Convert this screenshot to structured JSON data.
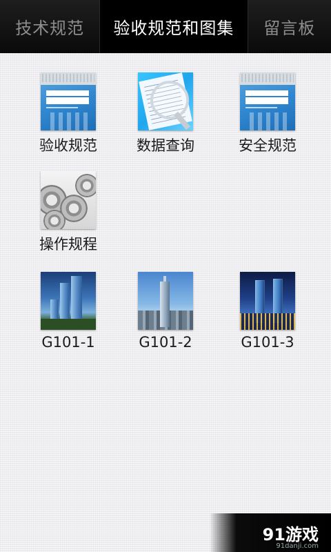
{
  "tabs": [
    {
      "label": "技术规范"
    },
    {
      "label": "验收规范和图集"
    },
    {
      "label": "留言板"
    }
  ],
  "grid": {
    "items": [
      {
        "label": "验收规范",
        "icon": "book-cover-icon"
      },
      {
        "label": "数据查询",
        "icon": "magnifier-document-icon"
      },
      {
        "label": "安全规范",
        "icon": "book-cover-icon"
      },
      {
        "label": "操作规程",
        "icon": "gears-icon"
      },
      {
        "label": "G101-1",
        "icon": "building-photo-icon"
      },
      {
        "label": "G101-2",
        "icon": "building-photo-icon"
      },
      {
        "label": "G101-3",
        "icon": "building-photo-icon"
      }
    ]
  },
  "watermark": {
    "text": "91游戏",
    "url": "91danji.com"
  },
  "colors": {
    "tabbar_bg": "#0b0b0b",
    "active_tab_text": "#ffffff",
    "inactive_tab_text": "#8d8d8d",
    "page_bg": "#eeeef1"
  }
}
